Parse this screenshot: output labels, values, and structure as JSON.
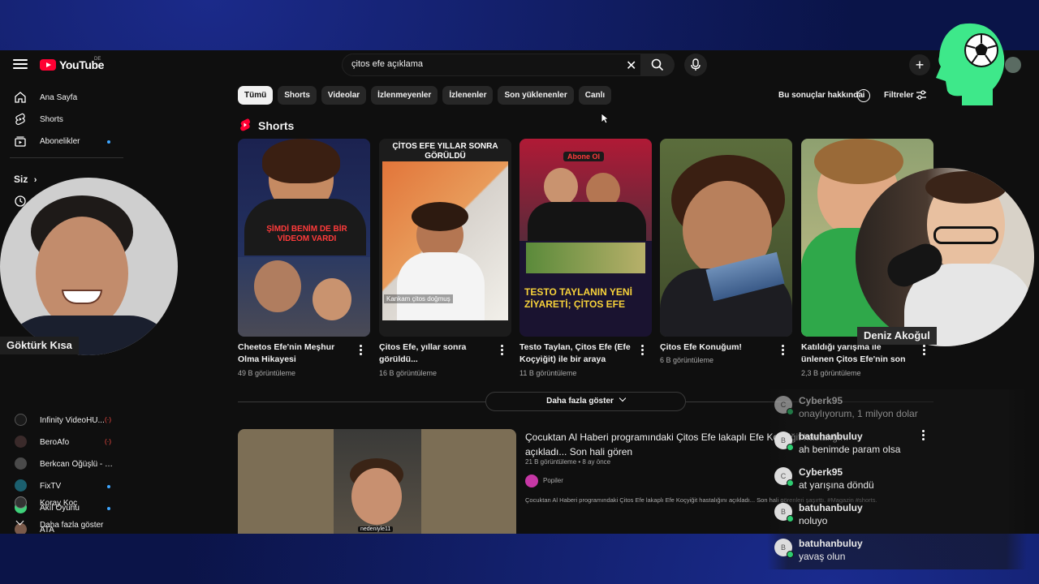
{
  "brand": {
    "logo_text": "YouTube",
    "country": "DE",
    "accent": "#ff0033"
  },
  "search": {
    "value": "çitos efe açıklama",
    "clear_icon": "close-icon",
    "search_icon": "search-icon",
    "mic_icon": "mic-icon"
  },
  "topbar": {
    "create_label": "+"
  },
  "sidebar": {
    "items": [
      {
        "label": "Ana Sayfa",
        "icon": "home-icon"
      },
      {
        "label": "Shorts",
        "icon": "shorts-icon"
      },
      {
        "label": "Abonelikler",
        "icon": "subscriptions-icon"
      }
    ],
    "you_label": "Siz",
    "subscriptions": [
      {
        "label": "Infinity VideoHU...",
        "status": "(·)",
        "color": "#1a1a1a"
      },
      {
        "label": "BeroAfo",
        "status": "(·)",
        "color": "#3a2a2a"
      },
      {
        "label": "Berkcan Öğüşlü - M...",
        "color": "#4a4a4a"
      },
      {
        "label": "FixTV",
        "color": "#1b5f6e"
      },
      {
        "label": "Akıl Oyunu",
        "color": "#3fd17a"
      },
      {
        "label": "ATA",
        "color": "#7a5a4a"
      },
      {
        "label": "Koray Koç",
        "color": "#333333"
      }
    ],
    "show_more": "Daha fazla göster"
  },
  "chips": [
    "Tümü",
    "Shorts",
    "Videolar",
    "İzlenmeyenler",
    "İzlenenler",
    "Son yüklenenler",
    "Canlı"
  ],
  "about_results": "Bu sonuçlar hakkında",
  "filters": "Filtreler",
  "shorts": {
    "title": "Shorts",
    "items": [
      {
        "title": "Cheetos Efe'nin Meşhur Olma Hikayesi",
        "views": "49 B görüntüleme",
        "overlay": "ŞİMDİ BENİM DE BİR VİDEOM VARDI"
      },
      {
        "title": "Çitos Efe, yıllar sonra görüldü...",
        "views": "16 B görüntüleme",
        "overlay": "ÇİTOS EFE YILLAR SONRA GÖRÜLDÜ",
        "caption": "Kankam çitos doğmuş"
      },
      {
        "title": "Testo Taylan, Çitos Efe (Efe Koçyiğit) ile bir araya geldi...",
        "views": "11 B görüntüleme",
        "overlay": "TESTO TAYLANIN YENİ ZİYARETİ; ÇİTOS EFE",
        "badge": "Abone Ol"
      },
      {
        "title": "Çitos Efe Konuğum!",
        "views": "6 B görüntüleme"
      },
      {
        "title": "Katıldığı yarışma ile ünlenen Çitos Efe'nin son ...",
        "views": "2,3 B görüntüleme"
      }
    ],
    "show_more": "Daha fazla göster"
  },
  "video": {
    "title": "Çocuktan Al Haberi programındaki Çitos Efe lakaplı Efe Koçyiğit hastalığını açıkladı... Son hali gören",
    "views": "21 B görüntüleme",
    "age": "8 ay önce",
    "channel": "Popiler",
    "description": "Çocuktan Al Haberi programındaki Çitos Efe lakaplı Efe Koçyiğit hastalığını açıkladı... Son hali görenleri şaşırttı. #Magazin #shorts.",
    "thumb_caption": "nedeniyle11"
  },
  "streamers": {
    "left_name": "Göktürk Kısa",
    "right_name": "Deniz Akoğul"
  },
  "chat": [
    {
      "user": "Cyberk95",
      "text": "onaylıyorum, 1 milyon dolar",
      "initial": "C"
    },
    {
      "user": "batuhanbuluy",
      "text": "ah benimde param olsa",
      "initial": "B"
    },
    {
      "user": "Cyberk95",
      "text": "at yarışına döndü",
      "initial": "C"
    },
    {
      "user": "batuhanbuluy",
      "text": "noluyo",
      "initial": "B"
    },
    {
      "user": "batuhanbuluy",
      "text": "yavaş olun",
      "initial": "B"
    }
  ]
}
